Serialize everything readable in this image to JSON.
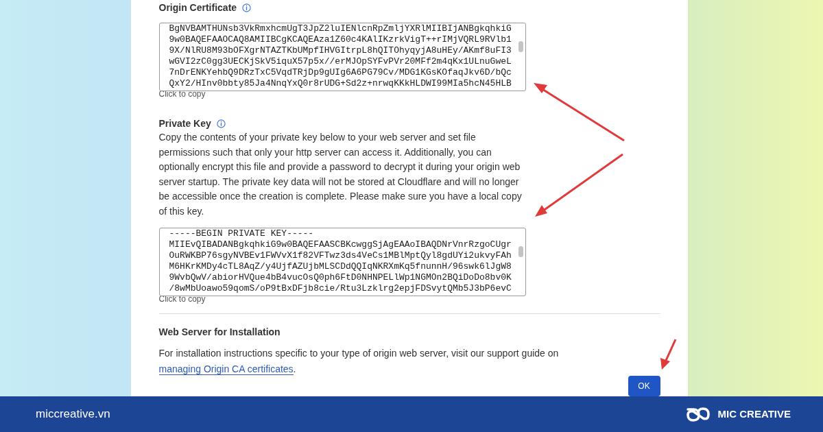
{
  "certificate": {
    "title": "Origin Certificate",
    "lines": [
      "BgNVBAMTHUNsb3VkRmxhcmUgT3JpZ2luIENlcnRpZmljYXRlMIIBIjANBgkqhkiG",
      "9w0BAQEFAAOCAQ8AMIIBCgKCAQEAza1Z60c4KAlIKzrkVigT++rIMjVQRL9RVlb1",
      "9X/NlRU8M93bOFXgrNTAZTKbUMpfIHVGItrpL8hQITOhyqyjA8uHEy/AKmf8uFI3",
      "wGVI2zC0gg3UECKjSkV5iquX57p5x//erMJOpSYFvPVr20MFf2m4qKx1ULnuGweL",
      "7nDrENKYehbQ9DRzTxC5VqdTRjDp9gUIg6A6PG79Cv/MDG1KGsKOfaqJkv6D/bQc",
      "QxY2/HInv0bbty85Ja4NnqYxQ0r8rUDG+Sd2z+nrwqKKkHLDWI99MIa5hcN45HLB"
    ],
    "copy_hint": "Click to copy"
  },
  "private_key": {
    "title": "Private Key",
    "description": "Copy the contents of your private key below to your web server and set file permissions such that only your http server can access it. Additionally, you can optionally encrypt this file and provide a password to decrypt it during your origin web server startup. The private key data will not be stored at Cloudflare and will no longer be accessible once the creation is complete. Please make sure you have a local copy of this key.",
    "lines": [
      "-----BEGIN PRIVATE KEY-----",
      "MIIEvQIBADANBgkqhkiG9w0BAQEFAASCBKcwggSjAgEAAoIBAQDNrVnrRzgoCUgr",
      "OuRWKBP76sgyNVBEv1FWVvX1f82VFTwz3ds4VeCs1MBlMptQyl8gdUYi2ukvyFAh",
      "M6HKrKMDy4cTL8AqZ/y4UjfAZUjbMLSCDdQQIqNKRXmKq5fnunnH/96swk6lJgW8",
      "9WvbQwV/abiorHVQue4bB4vucOsQ0ph6FtD0NHNPELlWp1NGMOn2BQiDoDo8bv0K",
      "/8wMbUoawo59qomS/oP9tBxDFjb8cie/Rtu3Lzklrg2epjFDSvytQMb5J3bP6evC"
    ],
    "copy_hint": "Click to copy"
  },
  "web_server": {
    "title": "Web Server for Installation",
    "text": "For installation instructions specific to your type of origin web server, visit our support guide on",
    "link": "managing Origin CA certificates",
    "after": "."
  },
  "ok_button": "OK",
  "footer": {
    "site": "miccreative.vn",
    "brand": "MIC CREATIVE"
  }
}
